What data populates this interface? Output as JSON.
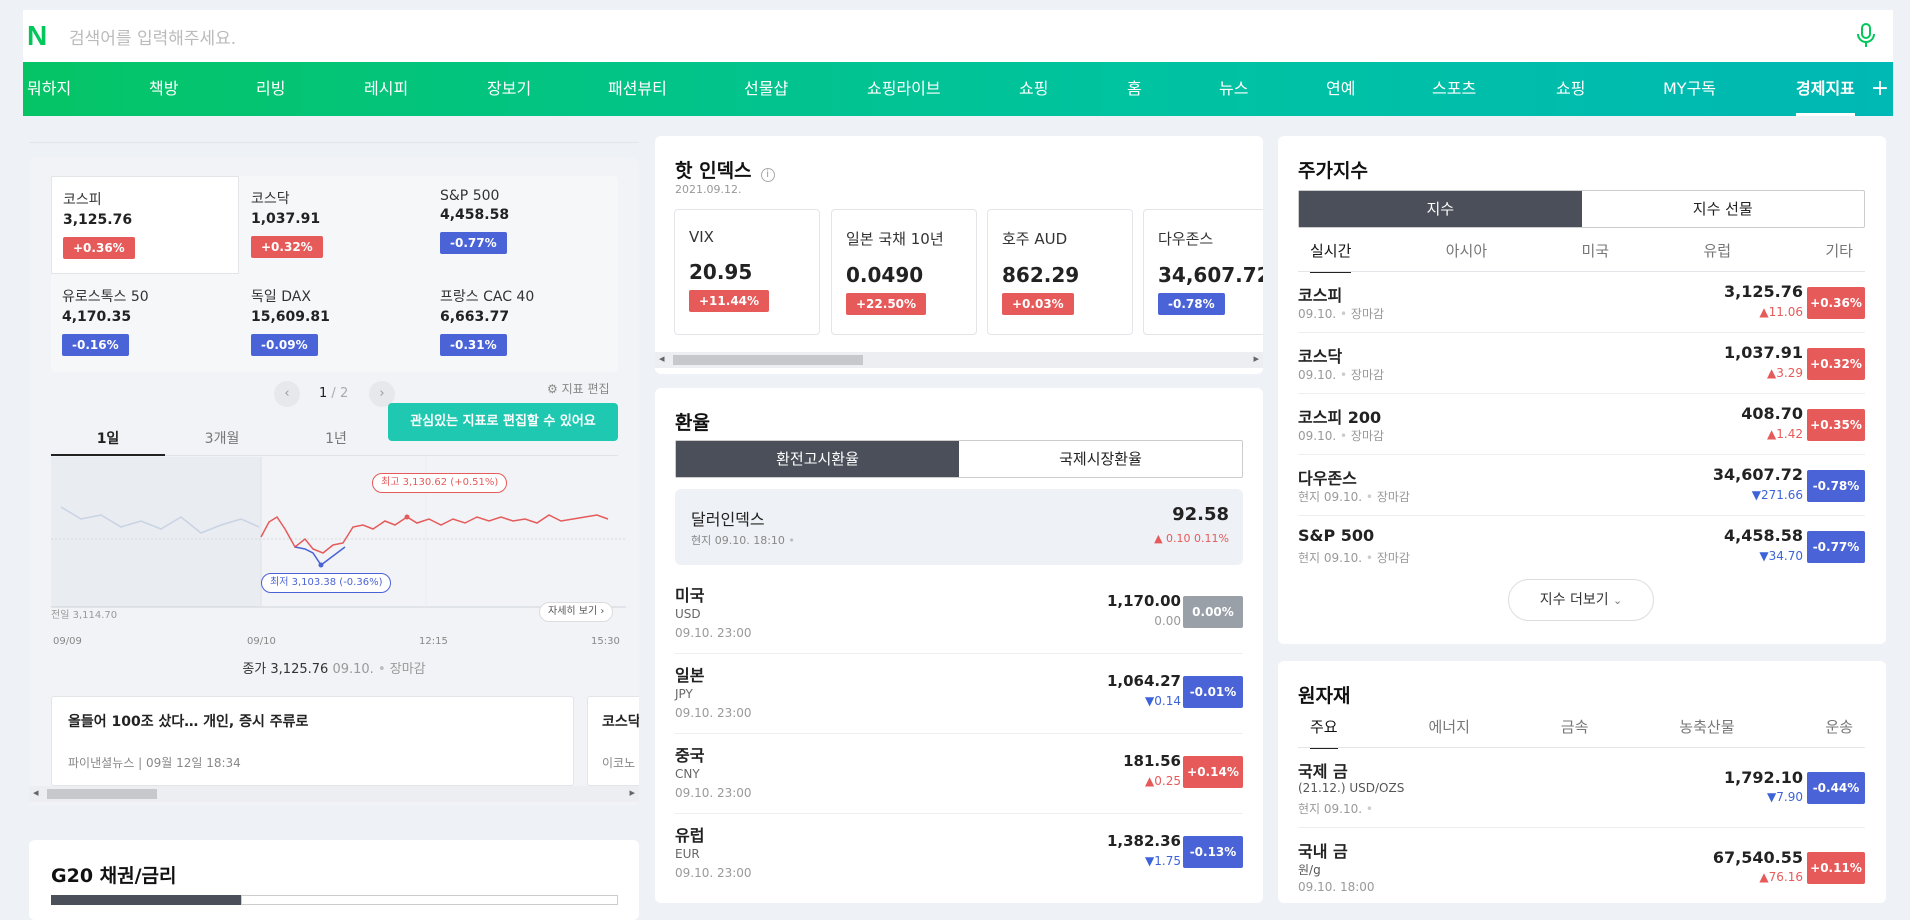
{
  "search": {
    "placeholder": "검색어를 입력해주세요."
  },
  "nav": {
    "items": [
      "뭐하지",
      "책방",
      "리빙",
      "레시피",
      "장보기",
      "패션뷰티",
      "선물샵",
      "쇼핑라이브",
      "쇼핑",
      "홈",
      "뉴스",
      "연예",
      "스포츠",
      "쇼핑",
      "MY구독",
      "경제지표"
    ],
    "plus": "+"
  },
  "left": {
    "indices": [
      {
        "name": "코스피",
        "value": "3,125.76",
        "change": "+0.36%",
        "dir": "up"
      },
      {
        "name": "코스닥",
        "value": "1,037.91",
        "change": "+0.32%",
        "dir": "up"
      },
      {
        "name": "S&P 500",
        "value": "4,458.58",
        "change": "-0.77%",
        "dir": "down"
      },
      {
        "name": "유로스톡스 50",
        "value": "4,170.35",
        "change": "-0.16%",
        "dir": "down"
      },
      {
        "name": "독일 DAX",
        "value": "15,609.81",
        "change": "-0.09%",
        "dir": "down"
      },
      {
        "name": "프랑스 CAC 40",
        "value": "6,663.77",
        "change": "-0.31%",
        "dir": "down"
      }
    ],
    "page_current": "1",
    "page_sep": "/",
    "page_total": "2",
    "edit_label": "지표 편집",
    "tooltip": "관심있는 지표로 편집할 수 있어요",
    "periods": [
      "1일",
      "3개월",
      "1년"
    ],
    "chart": {
      "high_label": "최고 3,130.62 (+0.51%)",
      "low_label": "최저 3,103.38 (-0.36%)",
      "prev_label": "전일 3,114.70",
      "detail_label": "자세히 보기",
      "x_ticks": [
        "09/09",
        "09/10",
        "12:15",
        "15:30"
      ],
      "up_color": "#e65a5a",
      "down_color": "#4a63d6"
    },
    "close_label": "종가 3,125.76",
    "close_date": "09.10.",
    "close_status": "장마감",
    "news": [
      {
        "title": "올들어 100조 샀다… 개인, 증시 주류로",
        "source": "파이낸셜뉴스",
        "date": "09월 12일 18:34"
      },
      {
        "title": "코스닥",
        "source": "이코노",
        "date": ""
      }
    ],
    "bond_title": "G20 채권/금리"
  },
  "hot": {
    "title": "핫 인덱스",
    "date": "2021.09.12.",
    "items": [
      {
        "name": "VIX",
        "value": "20.95",
        "change": "+11.44%",
        "dir": "up"
      },
      {
        "name": "일본 국채 10년",
        "value": "0.0490",
        "change": "+22.50%",
        "dir": "up"
      },
      {
        "name": "호주 AUD",
        "value": "862.29",
        "change": "+0.03%",
        "dir": "up"
      },
      {
        "name": "다우존스",
        "value": "34,607.72",
        "change": "-0.78%",
        "dir": "down"
      }
    ]
  },
  "fx": {
    "title": "환율",
    "tabs": [
      "환전고시환율",
      "국제시장환율"
    ],
    "dollar_index": {
      "name": "달러인덱스",
      "time": "현지 09.10. 18:10",
      "value": "92.58",
      "change": "0.10",
      "pct": "0.11%"
    },
    "rows": [
      {
        "name": "미국",
        "code": "USD",
        "time": "09.10. 23:00",
        "value": "1,170.00",
        "change": "0.00",
        "badge": "0.00%",
        "dir": "flat"
      },
      {
        "name": "일본",
        "code": "JPY",
        "time": "09.10. 23:00",
        "value": "1,064.27",
        "change": "0.14",
        "badge": "-0.01%",
        "dir": "down"
      },
      {
        "name": "중국",
        "code": "CNY",
        "time": "09.10. 23:00",
        "value": "181.56",
        "change": "0.25",
        "badge": "+0.14%",
        "dir": "up"
      },
      {
        "name": "유럽",
        "code": "EUR",
        "time": "09.10. 23:00",
        "value": "1,382.36",
        "change": "1.75",
        "badge": "-0.13%",
        "dir": "down"
      }
    ]
  },
  "stock": {
    "title": "주가지수",
    "tabs": [
      "지수",
      "지수 선물"
    ],
    "subtabs": [
      "실시간",
      "아시아",
      "미국",
      "유럽",
      "기타"
    ],
    "rows": [
      {
        "name": "코스피",
        "sub": "09.10.",
        "status": "장마감",
        "value": "3,125.76",
        "change": "11.06",
        "badge": "+0.36%",
        "dir": "up"
      },
      {
        "name": "코스닥",
        "sub": "09.10.",
        "status": "장마감",
        "value": "1,037.91",
        "change": "3.29",
        "badge": "+0.32%",
        "dir": "up"
      },
      {
        "name": "코스피 200",
        "sub": "09.10.",
        "status": "장마감",
        "value": "408.70",
        "change": "1.42",
        "badge": "+0.35%",
        "dir": "up"
      },
      {
        "name": "다우존스",
        "sub": "현지 09.10.",
        "status": "장마감",
        "value": "34,607.72",
        "change": "271.66",
        "badge": "-0.78%",
        "dir": "down"
      },
      {
        "name": "S&P 500",
        "sub": "현지 09.10.",
        "status": "장마감",
        "value": "4,458.58",
        "change": "34.70",
        "badge": "-0.77%",
        "dir": "down"
      }
    ],
    "more": "지수 더보기"
  },
  "commodity": {
    "title": "원자재",
    "subtabs": [
      "주요",
      "에너지",
      "금속",
      "농축산물",
      "운송"
    ],
    "rows": [
      {
        "name": "국제 금",
        "sub1": "(21.12.) USD/OZS",
        "sub2": "현지 09.10.",
        "value": "1,792.10",
        "change": "7.90",
        "badge": "-0.44%",
        "dir": "down"
      },
      {
        "name": "국내 금",
        "sub1": "원/g",
        "sub2": "09.10. 18:00",
        "value": "67,540.55",
        "change": "76.16",
        "badge": "+0.11%",
        "dir": "up"
      }
    ]
  }
}
